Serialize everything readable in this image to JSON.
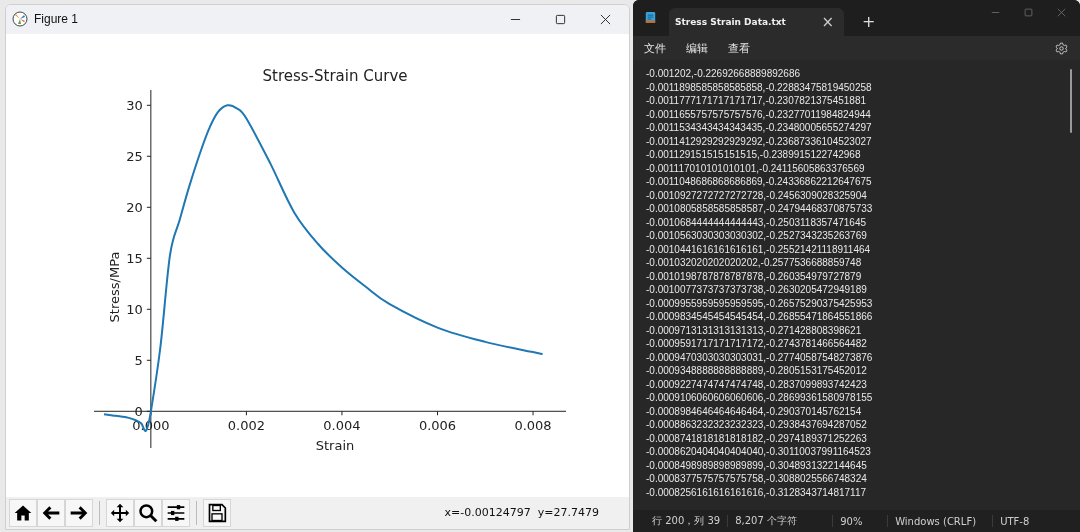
{
  "figure_window": {
    "title": "Figure 1",
    "chart_data": {
      "type": "line",
      "title": "Stress-Strain Curve",
      "xlabel": "Strain",
      "ylabel": "Stress/MPa",
      "x": [
        -0.00098,
        -0.0008,
        -0.0005,
        -0.0003,
        -0.0002,
        -0.0001,
        0,
        0.0002,
        0.0004,
        0.0006,
        0.0008,
        0.001,
        0.0012,
        0.0014,
        0.0016,
        0.0018,
        0.002,
        0.0025,
        0.003,
        0.0035,
        0.004,
        0.0045,
        0.005,
        0.006,
        0.007,
        0.008,
        0.0082
      ],
      "series": [
        {
          "color": "#1f77b4",
          "values": [
            -0.3,
            -0.4,
            -0.6,
            -0.9,
            -1.2,
            -1.9,
            0,
            6.3,
            15.3,
            18.7,
            22,
            24.9,
            27.5,
            29.3,
            30,
            29.7,
            28.7,
            24.3,
            19.5,
            16.4,
            14.1,
            12.2,
            10.5,
            8.2,
            6.8,
            5.8,
            5.6
          ]
        }
      ],
      "xlim": [
        -0.00119,
        0.00869
      ],
      "ylim": [
        -3.6,
        31.5
      ],
      "xticks": [
        {
          "value": 0,
          "label": "0.000"
        },
        {
          "value": 0.002,
          "label": "0.002"
        },
        {
          "value": 0.004,
          "label": "0.004"
        },
        {
          "value": 0.006,
          "label": "0.006"
        },
        {
          "value": 0.008,
          "label": "0.008"
        }
      ],
      "yticks": [
        0,
        5,
        10,
        15,
        20,
        25,
        30
      ]
    },
    "toolbar": {
      "groups": [
        [
          {
            "kind": "home"
          },
          {
            "kind": "back"
          },
          {
            "kind": "forward"
          }
        ],
        [
          {
            "kind": "pan"
          },
          {
            "kind": "zoom"
          },
          {
            "kind": "configure"
          }
        ],
        [
          {
            "kind": "save"
          }
        ]
      ]
    },
    "coordinates": "x=-0.00124797  y=27.7479"
  },
  "notepad": {
    "tab": {
      "title": "Stress Strain Data.txt",
      "close": "×"
    },
    "new_tab": "+",
    "menu": [
      "文件",
      "编辑",
      "查看"
    ],
    "lines": [
      "-0.001202,-0.22692668889892686",
      "-0.0011898585858585858,-0.22883475819450258",
      "-0.0011777171717171717,-0.2307821375451881",
      "-0.0011655757575757576,-0.23277011984824944",
      "-0.0011534343434343435,-0.23480005655274297",
      "-0.0011412929292929292,-0.23687336104523027",
      "-0.001129151515151515,-0.2389915122742968",
      "-0.001117010101010101,-0.24115605863376569",
      "-0.0011048686868686869,-0.24336862212647675",
      "-0.0010927272727272728,-0.2456309028325904",
      "-0.0010805858585858587,-0.24794468370875733",
      "-0.0010684444444444443,-0.2503118357471645",
      "-0.0010563030303030302,-0.2527343235263769",
      "-0.0010441616161616161,-0.25521421118911464",
      "-0.001032020202020202,-0.2577536688859748",
      "-0.0010198787878787878,-0.260354979727879",
      "-0.0010077373737373738,-0.2630205472949189",
      "-0.0009955959595959595,-0.26575290375425953",
      "-0.0009834545454545454,-0.26855471864551866",
      "-0.0009713131313131313,-0.271428808398621",
      "-0.0009591717171717172,-0.2743781466564482",
      "-0.0009470303030303031,-0.27740587548273876",
      "-0.0009348888888888889,-0.2805153175452012",
      "-0.0009227474747474748,-0.2837099893742423",
      "-0.0009106060606060606,-0.28699361580978155",
      "-0.0008984646464646464,-0.290370145762154",
      "-0.0008863232323232323,-0.2938437694287052",
      "-0.0008741818181818182,-0.2974189371252263",
      "-0.0008620404040404040,-0.30110037991164523",
      "-0.0008498989898989899,-0.3048931322144645",
      "-0.0008377575757575758,-0.3088025566748324",
      "-0.0008256161616161616,-0.3128343714817117"
    ],
    "status": [
      "行 200，列 39",
      "8,207 个字符",
      "90%",
      "Windows (CRLF)",
      "UTF-8"
    ]
  }
}
